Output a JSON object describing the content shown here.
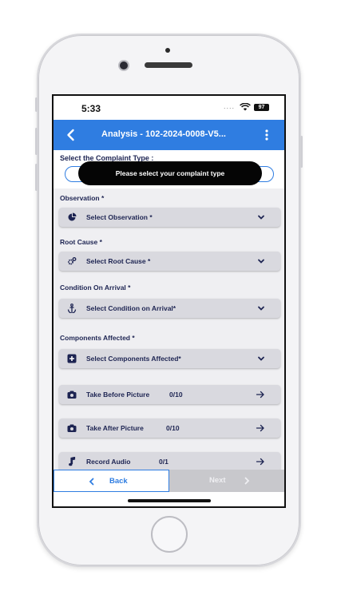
{
  "status_bar": {
    "time": "5:33",
    "signal": "....",
    "battery": "97"
  },
  "app_bar": {
    "title": "Analysis - 102-2024-0008-V5..."
  },
  "complaint": {
    "title": "Select the Complaint Type :",
    "toast": "Please select your complaint type"
  },
  "observation": {
    "label": "Observation *",
    "placeholder": "Select Observation *"
  },
  "root_cause": {
    "label": "Root Cause *",
    "placeholder": "Select Root Cause *"
  },
  "condition": {
    "label": "Condition On Arrival *",
    "placeholder": "Select Condition on Arrival*"
  },
  "components": {
    "label": "Components Affected *",
    "placeholder": "Select Components Affected*"
  },
  "before_picture": {
    "label": "Take Before Picture",
    "count": "0/10"
  },
  "after_picture": {
    "label": "Take After Picture",
    "count": "0/10"
  },
  "record_audio": {
    "label": "Record Audio",
    "count": "0/1"
  },
  "footer": {
    "back_label": "Back",
    "next_label": "Next"
  },
  "colors": {
    "primary": "#2f7de1",
    "text": "#1d2452",
    "field_bg": "#d9d9df",
    "disabled": "#c8c8cc"
  }
}
